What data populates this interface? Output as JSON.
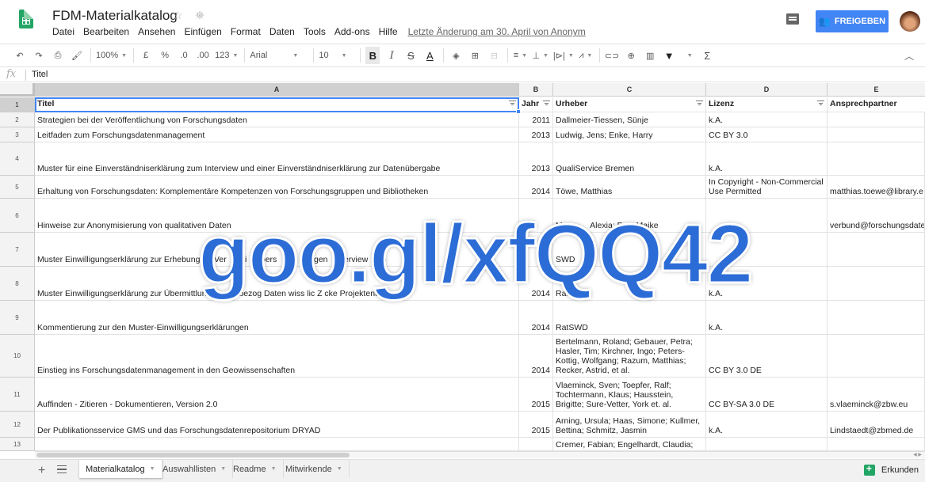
{
  "app": {
    "doc_title": "FDM-Materialkatalog",
    "share_label": "FREIGEBEN",
    "last_edit": "Letzte Änderung am 30. April von Anonym"
  },
  "menu": [
    "Datei",
    "Bearbeiten",
    "Ansehen",
    "Einfügen",
    "Format",
    "Daten",
    "Tools",
    "Add-ons",
    "Hilfe"
  ],
  "toolbar": {
    "zoom": "100%",
    "currency": "£",
    "percent": "%",
    "dec_less": ".0",
    "dec_more": ".00",
    "more_formats": "123",
    "font": "Arial",
    "font_size": "10",
    "bold": "B",
    "italic": "I",
    "strike": "S",
    "text_color": "A",
    "sum": "Σ"
  },
  "formula_bar": {
    "value": "Titel"
  },
  "columns": [
    "A",
    "B",
    "C",
    "D",
    "E"
  ],
  "rows": [
    {
      "n": "1",
      "title": "Titel",
      "year": "Jahr",
      "author": "Urheber",
      "license": "Lizenz",
      "contact": "Ansprechpartner"
    },
    {
      "n": "2",
      "title": "Strategien bei der Veröffentlichung von Forschungsdaten",
      "year": "2011",
      "author": "Dallmeier-Tiessen, Sünje",
      "license": "k.A.",
      "contact": ""
    },
    {
      "n": "3",
      "title": "Leitfaden zum Forschungsdatenmanagement",
      "year": "2013",
      "author": "Ludwig, Jens; Enke, Harry",
      "license": "CC BY 3.0",
      "contact": ""
    },
    {
      "n": "4",
      "title": "Muster für eine Einverständniserklärung zum Interview und einer Einverständniserklärung zur Datenübergabe",
      "year": "2013",
      "author": "QualiService Bremen",
      "license": "k.A.",
      "contact": ""
    },
    {
      "n": "5",
      "title": "Erhaltung von Forschungsdaten: Komplementäre Kompetenzen von Forschungsgruppen und Bibliotheken",
      "year": "2014",
      "author": "Töwe, Matthias",
      "license": "In Copyright - Non-Commercial Use Permitted",
      "contact": "matthias.toewe@library.e"
    },
    {
      "n": "6",
      "title": "Hinweise zur Anonymisierung von qualitativen Daten",
      "year": "",
      "author": "Me          Alexia; F      Maike",
      "license": "",
      "contact": "verbund@forschungsdate"
    },
    {
      "n": "7",
      "title": "Muster Einwilligungserklärung zur Erhebung      Ver      ei      pers      n      ogen      terview      n",
      "year": "4",
      "author": "SWD",
      "license": "",
      "contact": ""
    },
    {
      "n": "8",
      "title": "Muster Einwilligungserklärung zur Übermittlung      ung      enbezog      Daten      wiss      lic      Z      cke Projektende",
      "year": "2014",
      "author": "RatSWD",
      "license": "k.A.",
      "contact": ""
    },
    {
      "n": "9",
      "title": "Kommentierung zur den Muster-Einwilligungserklärungen",
      "year": "2014",
      "author": "RatSWD",
      "license": "k.A.",
      "contact": ""
    },
    {
      "n": "10",
      "title": "Einstieg ins Forschungsdatenmanagement in den Geowissenschaften",
      "year": "2014",
      "author": "Bertelmann, Roland;  Gebauer, Petra; Hasler, Tim; Kirchner, Ingo; Peters-Kottig, Wolfgang; Razum, Matthias; Recker, Astrid, et al.",
      "license": "CC BY 3.0 DE",
      "contact": ""
    },
    {
      "n": "11",
      "title": "Auffinden - Zitieren - Dokumentieren, Version 2.0",
      "year": "2015",
      "author": "Vlaeminck, Sven; Toepfer, Ralf; Tochtermann, Klaus; Hausstein, Brigitte; Sure-Vetter, York et. al.",
      "license": "CC BY-SA 3.0 DE",
      "contact": "s.vlaeminck@zbw.eu"
    },
    {
      "n": "12",
      "title": "Der Publikationsservice GMS und das Forschungsdatenrepositorium DRYAD",
      "year": "2015",
      "author": "Arning, Ursula; Haas, Simone; Kullmer, Bettina; Schmitz, Jasmin",
      "license": "k.A.",
      "contact": "Lindstaedt@zbmed.de"
    },
    {
      "n": "13",
      "title": "",
      "year": "",
      "author": "Cremer, Fabian; Engelhardt, Claudia;",
      "license": "",
      "contact": ""
    }
  ],
  "overlay_text": "goo.gl/xfQQ42",
  "sheets": [
    "Materialkatalog",
    "Auswahllisten",
    "Readme",
    "Mitwirkende"
  ],
  "explore_label": "Erkunden"
}
